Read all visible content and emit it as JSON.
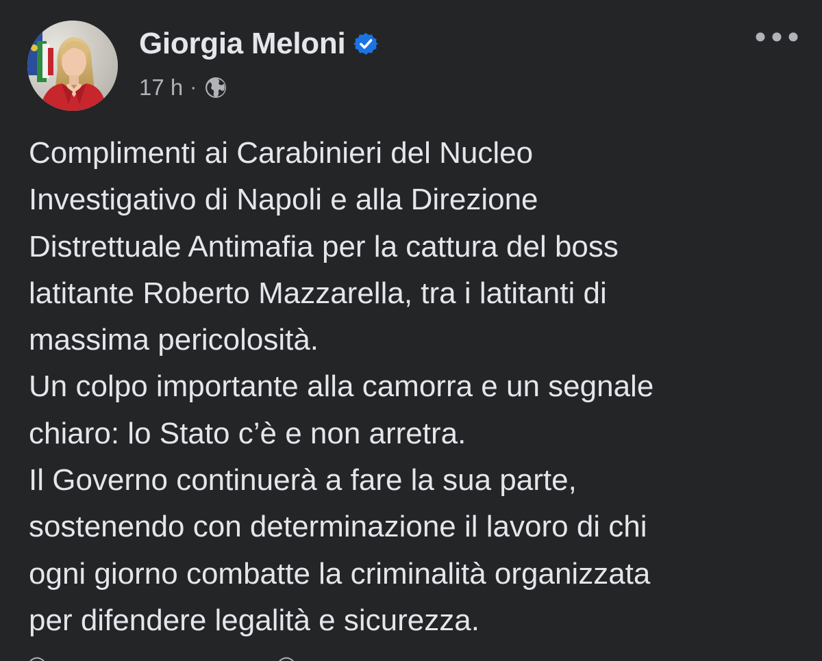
{
  "post": {
    "author": {
      "name": "Giorgia Meloni",
      "verified": true
    },
    "meta": {
      "time": "17 h",
      "separator": "·",
      "audience_icon": "globe-icon"
    },
    "more_icon": "more-horizontal-icon",
    "body_lines": [
      "Complimenti ai Carabinieri del Nucleo",
      "Investigativo di Napoli e alla Direzione",
      "Distrettuale Antimafia per la cattura del boss",
      "latitante Roberto Mazzarella, tra i latitanti di",
      "massima pericolosità.",
      "Un colpo importante alla camorra e un segnale",
      "chiaro: lo Stato c’è e non arretra.",
      "Il Governo continuerà a fare la sua parte,",
      "sostenendo con determinazione il lavoro di chi",
      "ogni giorno combatte la criminalità organizzata",
      "per difendere legalità e sicurezza."
    ]
  },
  "colors": {
    "background": "#242527",
    "text_primary": "#e4e6eb",
    "text_secondary": "#b0b3b8",
    "verified_badge": "#1b74e4"
  }
}
